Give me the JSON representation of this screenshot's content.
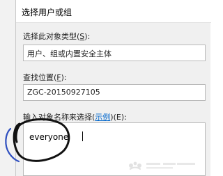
{
  "dialog": {
    "title": "选择用户或组",
    "object_type": {
      "label_prefix": "选择此对象类型(",
      "label_key": "S",
      "label_suffix": "):",
      "value": "用户、组或内置安全主体"
    },
    "location": {
      "label_prefix": "查找位置(",
      "label_key": "F",
      "label_suffix": "):",
      "value": "ZGC-20150927105"
    },
    "enter_names": {
      "label_main": "输入对象名称来选择(",
      "examples_link": "示例",
      "label_end": ")(E):",
      "value": "everyone"
    }
  },
  "colors": {
    "dialog_bg": "#f0f0f0",
    "link": "#0066cc",
    "annotation_ink": "#111111",
    "annotation_blue": "#2f4fbf"
  },
  "icons": {
    "watermark": "baidu-watermark-logo"
  }
}
